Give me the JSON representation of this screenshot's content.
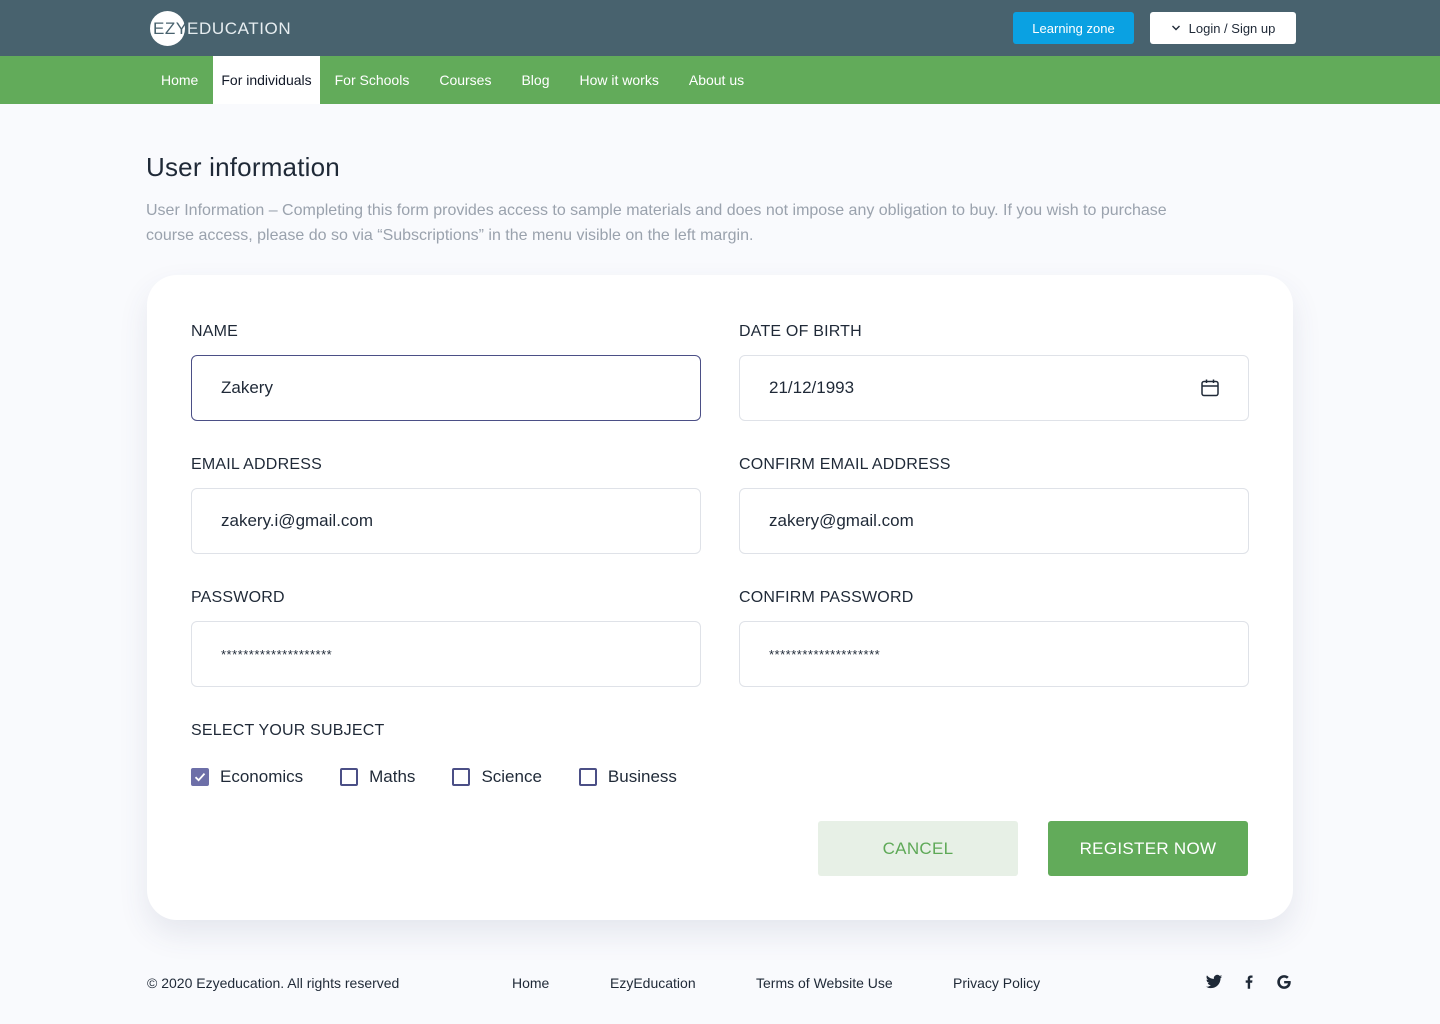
{
  "header": {
    "logo_badge": "EZY",
    "logo_text": "EDUCATION",
    "learning_zone_label": "Learning zone",
    "login_label": "Login / Sign up",
    "login_icon": "chevron-down-icon"
  },
  "nav": {
    "items": [
      {
        "label": "Home"
      },
      {
        "label": "For individuals",
        "active": true
      },
      {
        "label": "For Schools"
      },
      {
        "label": "Courses"
      },
      {
        "label": "Blog"
      },
      {
        "label": "How it works"
      },
      {
        "label": "About us"
      }
    ]
  },
  "page": {
    "title": "User information",
    "description": "User Information – Completing this form provides access to sample materials and does not impose any obligation to buy. If you wish to purchase course access, please do so via “Subscriptions” in the menu visible on the left margin."
  },
  "form": {
    "name": {
      "label": "NAME",
      "value": "Zakery"
    },
    "dob": {
      "label": "DATE OF BIRTH",
      "value": "21/12/1993",
      "icon": "calendar-icon"
    },
    "email": {
      "label": "EMAIL ADDRESS",
      "value": "zakery.i@gmail.com"
    },
    "confirm_email": {
      "label": "CONFIRM EMAIL ADDRESS",
      "value": "zakery@gmail.com"
    },
    "password": {
      "label": "PASSWORD",
      "value": "********************"
    },
    "confirm_password": {
      "label": "CONFIRM PASSWORD",
      "value": "********************"
    },
    "subject": {
      "label": "SELECT YOUR SUBJECT",
      "options": [
        {
          "label": "Economics",
          "checked": true
        },
        {
          "label": "Maths",
          "checked": false
        },
        {
          "label": "Science",
          "checked": false
        },
        {
          "label": "Business",
          "checked": false
        }
      ]
    },
    "cancel_label": "CANCEL",
    "register_label": "REGISTER NOW"
  },
  "footer": {
    "copyright": "© 2020 Ezyeducation. All rights reserved",
    "links": [
      "Home",
      "EzyEducation",
      "Terms of Website Use",
      "Privacy Policy"
    ],
    "social": [
      "twitter-icon",
      "facebook-icon",
      "google-icon"
    ]
  },
  "colors": {
    "topbar": "#48626e",
    "navbar": "#62ab5a",
    "learning_zone": "#0aa1e2",
    "checkbox_accent": "#4b4f86",
    "cancel_bg": "#e7f0e6"
  }
}
